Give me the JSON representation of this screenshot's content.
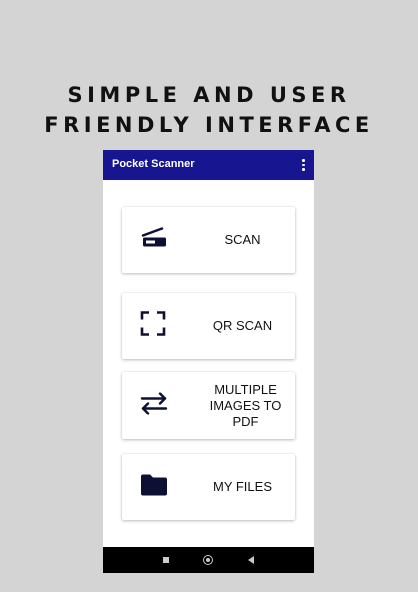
{
  "promo": {
    "line1": "SIMPLE AND USER",
    "line2": "FRIENDLY INTERFACE"
  },
  "appbar": {
    "title": "Pocket Scanner",
    "menu_icon": "more-vert-icon",
    "color": "#17158f"
  },
  "cards": [
    {
      "label": "SCAN",
      "icon": "scanner-icon"
    },
    {
      "label": "QR SCAN",
      "icon": "qr-scan-frame-icon"
    },
    {
      "label": "MULTIPLE IMAGES TO PDF",
      "icon": "swap-arrows-icon"
    },
    {
      "label": "MY FILES",
      "icon": "folder-icon"
    }
  ],
  "navbar": {
    "icons": [
      "recents-square-icon",
      "home-circle-icon",
      "back-triangle-icon"
    ]
  }
}
